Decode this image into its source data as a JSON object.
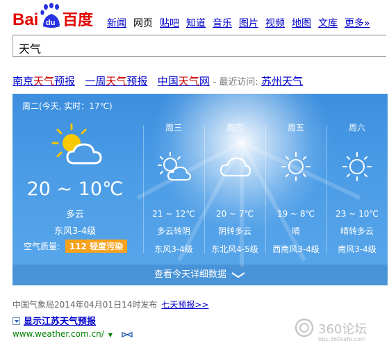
{
  "header": {
    "logo_text_left": "Bai",
    "logo_text_paw": "du",
    "logo_text_right": "百度",
    "nav": [
      {
        "label": "新闻",
        "active": false
      },
      {
        "label": "网页",
        "active": true
      },
      {
        "label": "贴吧",
        "active": false
      },
      {
        "label": "知道",
        "active": false
      },
      {
        "label": "音乐",
        "active": false
      },
      {
        "label": "图片",
        "active": false
      },
      {
        "label": "视频",
        "active": false
      },
      {
        "label": "地图",
        "active": false
      },
      {
        "label": "文库",
        "active": false
      },
      {
        "label": "更多»",
        "active": false
      }
    ]
  },
  "search": {
    "value": "天气"
  },
  "result_title": {
    "part1_a": "南京",
    "part1_b": "天气",
    "part1_c": "预报",
    "part2_a": "一周",
    "part2_b": "天气",
    "part2_c": "预报",
    "part3_a": "中国",
    "part3_b": "天气",
    "part3_c": "网",
    "recent_label": " - 最近访问: ",
    "recent_link": "苏州天气"
  },
  "weather": {
    "today_label": "周二(今天, 实时：17℃)",
    "today": {
      "temp": "20 ~ 10℃",
      "desc": "多云",
      "wind": "东风3-4级",
      "aqi_label": "空气质量: ",
      "aqi_value": "112 轻度污染",
      "icon": "partly-cloudy-icon"
    },
    "days": [
      {
        "name": "周三",
        "temp": "21 ~ 12℃",
        "desc": "多云转阴",
        "wind": "东风3-4级",
        "icon": "sun-cloud-icon"
      },
      {
        "name": "周四",
        "temp": "20 ~ 7℃",
        "desc": "阴转多云",
        "wind": "东北风4-5级",
        "icon": "cloud-icon"
      },
      {
        "name": "周五",
        "temp": "19 ~ 8℃",
        "desc": "晴",
        "wind": "西南风3-4级",
        "icon": "sun-icon"
      },
      {
        "name": "周六",
        "temp": "23 ~ 10℃",
        "desc": "晴转多云",
        "wind": "南风3-4级",
        "icon": "sun-icon"
      }
    ],
    "more_label": "查看今天详细数据"
  },
  "source": {
    "text": "中国气象局2014年04月01日14时发布",
    "link": "七天预报>>"
  },
  "show_province": {
    "label": "显示江苏天气预报"
  },
  "url": {
    "text": "www.weather.com.cn/"
  },
  "watermark": {
    "brand": "360论坛",
    "domain": "bbs.360safe.com"
  },
  "colors": {
    "card_bg": "#4b9ce6",
    "aqi_badge": "#f7a21c",
    "link": "#0000cc",
    "highlight": "#cc0000",
    "url_green": "#008000"
  }
}
